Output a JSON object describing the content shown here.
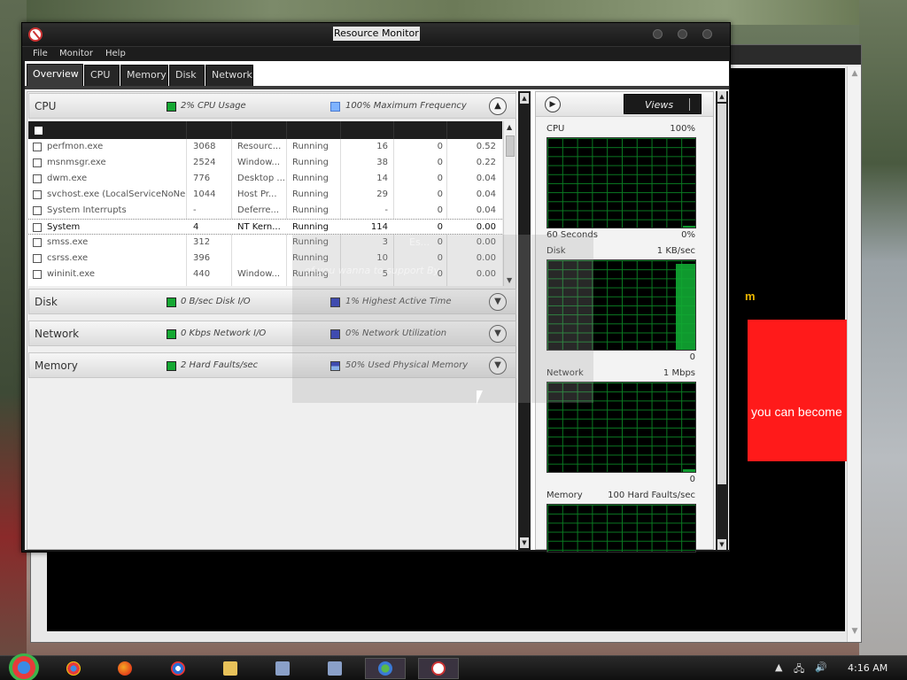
{
  "window": {
    "title": "Resource Monitor",
    "menu": [
      "File",
      "Monitor",
      "Help"
    ],
    "tabs": [
      "Overview",
      "CPU",
      "Memory",
      "Disk",
      "Network"
    ]
  },
  "cpu_section": {
    "name": "CPU",
    "stat1": "2% CPU Usage",
    "stat2": "100% Maximum Frequency",
    "stat1_color": "#15a832",
    "stat2_color": "#7fb3ff",
    "processes": [
      {
        "image": "perfmon.exe",
        "pid": "3068",
        "desc": "Resourc...",
        "status": "Running",
        "threads": "16",
        "cpu": "0",
        "avg": "0.52"
      },
      {
        "image": "msnmsgr.exe",
        "pid": "2524",
        "desc": "Window...",
        "status": "Running",
        "threads": "38",
        "cpu": "0",
        "avg": "0.22"
      },
      {
        "image": "dwm.exe",
        "pid": "776",
        "desc": "Desktop ...",
        "status": "Running",
        "threads": "14",
        "cpu": "0",
        "avg": "0.04"
      },
      {
        "image": "svchost.exe (LocalServiceNoNe...",
        "pid": "1044",
        "desc": "Host Pr...",
        "status": "Running",
        "threads": "29",
        "cpu": "0",
        "avg": "0.04"
      },
      {
        "image": "System Interrupts",
        "pid": "-",
        "desc": "Deferre...",
        "status": "Running",
        "threads": "-",
        "cpu": "0",
        "avg": "0.04"
      },
      {
        "image": "System",
        "pid": "4",
        "desc": "NT Kern...",
        "status": "Running",
        "threads": "114",
        "cpu": "0",
        "avg": "0.00"
      },
      {
        "image": "smss.exe",
        "pid": "312",
        "desc": "",
        "status": "Running",
        "threads": "3",
        "cpu": "0",
        "avg": "0.00"
      },
      {
        "image": "csrss.exe",
        "pid": "396",
        "desc": "",
        "status": "Running",
        "threads": "10",
        "cpu": "0",
        "avg": "0.00"
      },
      {
        "image": "wininit.exe",
        "pid": "440",
        "desc": "Window...",
        "status": "Running",
        "threads": "5",
        "cpu": "0",
        "avg": "0.00"
      }
    ]
  },
  "disk_section": {
    "name": "Disk",
    "stat1": "0 B/sec Disk I/O",
    "stat2": "1% Highest Active Time"
  },
  "network_section": {
    "name": "Network",
    "stat1": "0 Kbps Network I/O",
    "stat2": "0% Network Utilization"
  },
  "memory_section": {
    "name": "Memory",
    "stat1": "2 Hard Faults/sec",
    "stat2": "50% Used Physical Memory"
  },
  "colors": {
    "stat_green": "#15a832",
    "stat_blue": "#1f2fb5",
    "graph_green": "#11aa33",
    "accent_red": "#ff1a1a"
  },
  "right_pane": {
    "views_label": "Views",
    "graphs": [
      {
        "title": "CPU",
        "max": "100%",
        "foot_left": "60 Seconds",
        "foot_right": "0%",
        "level": 0.02
      },
      {
        "title": "Disk",
        "max": "1 KB/sec",
        "foot_left": "",
        "foot_right": "0",
        "level": 0.94
      },
      {
        "title": "Network",
        "max": "1 Mbps",
        "foot_left": "",
        "foot_right": "0",
        "level": 0.03
      },
      {
        "title": "Memory",
        "max": "100 Hard Faults/sec",
        "foot_left": "",
        "foot_right": "",
        "level": 0.0
      }
    ]
  },
  "background": {
    "red_box_text": "you can become",
    "yellow_text": "m",
    "overlay_line1": "Es...",
    "overlay_line2": "of you wanna to support By"
  },
  "taskbar": {
    "clock": "4:16 AM",
    "icons": [
      "chrome-icon",
      "firefox-icon",
      "chrome-icon",
      "folder-icon",
      "app-icon",
      "app-icon",
      "messenger-icon",
      "resource-monitor-icon"
    ]
  }
}
